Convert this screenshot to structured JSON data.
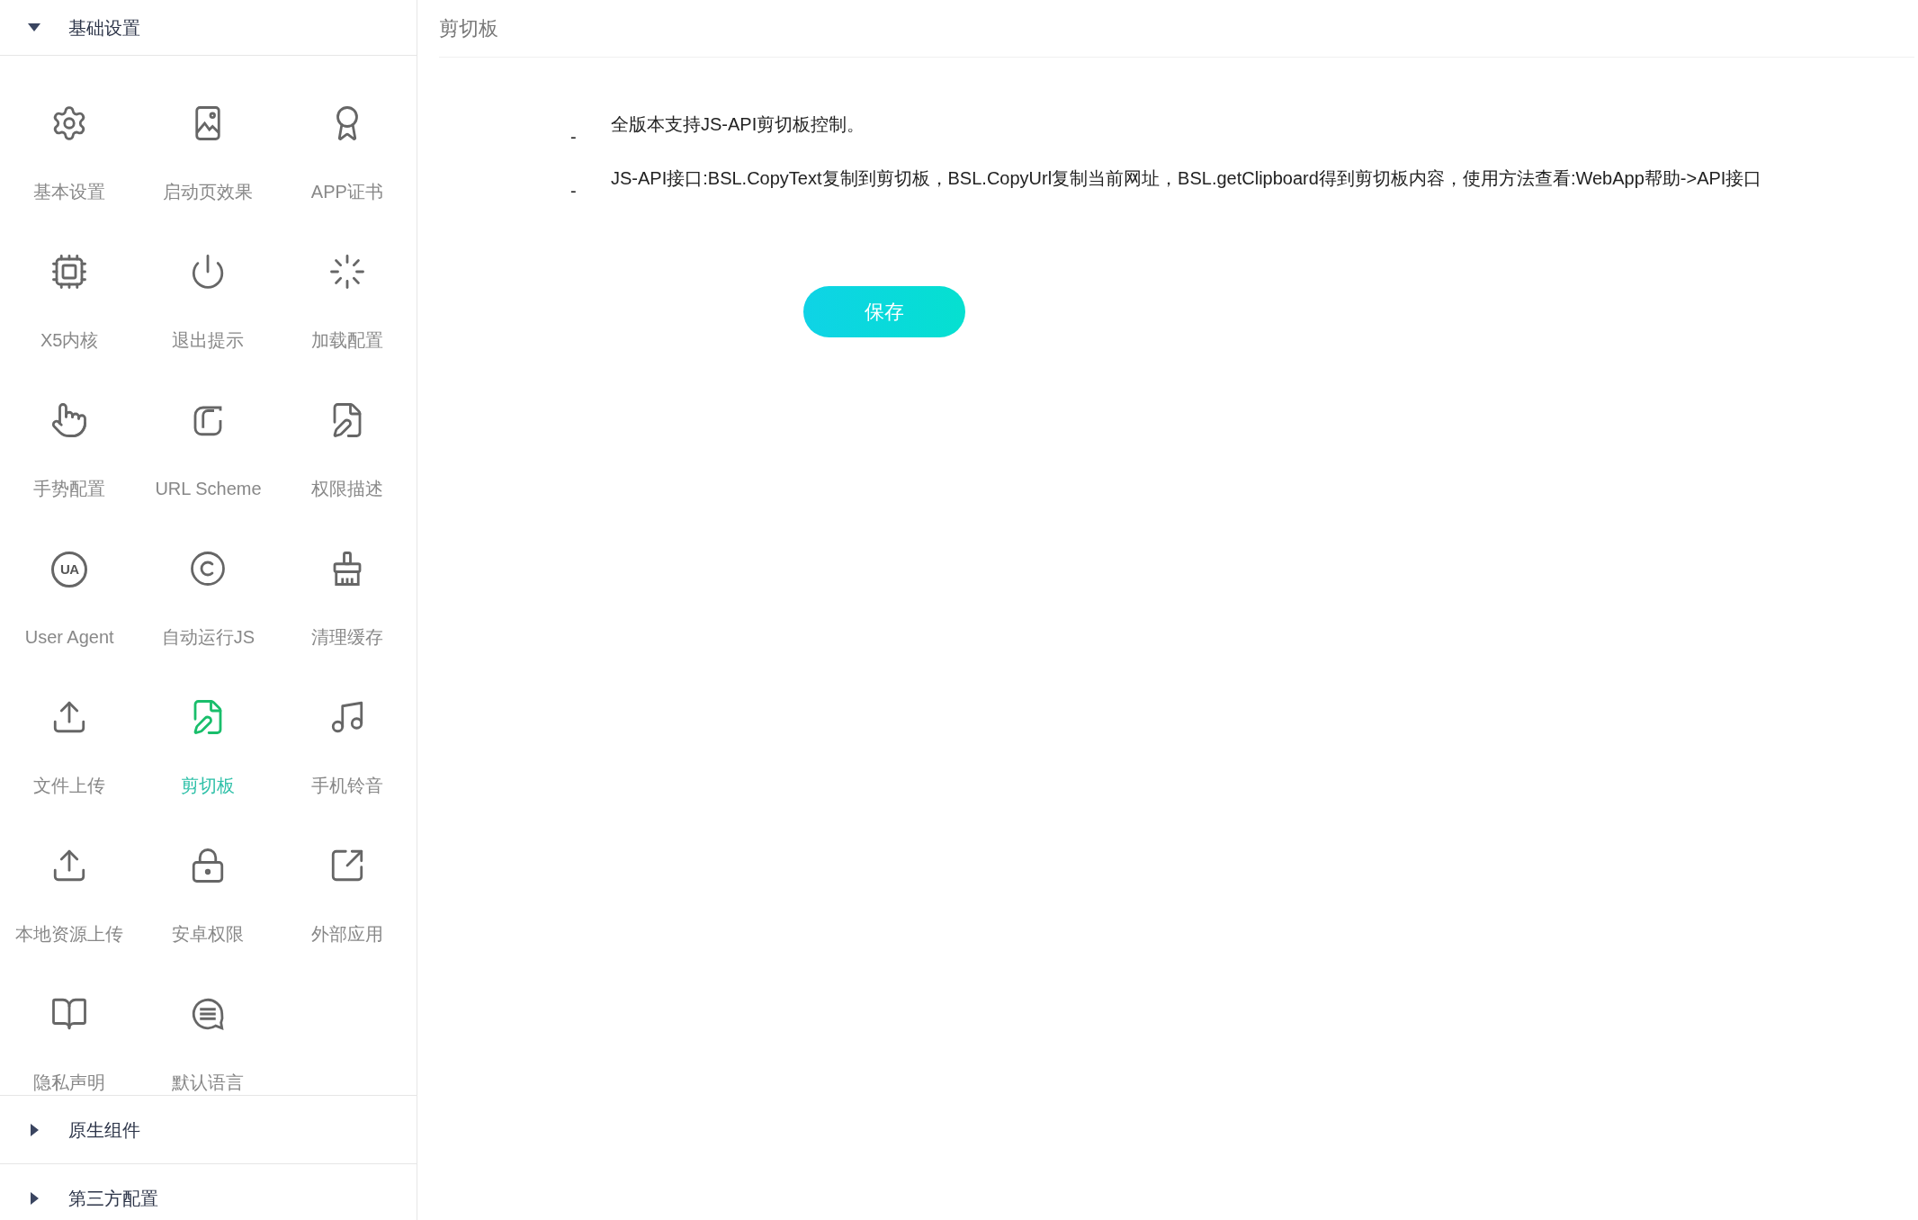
{
  "sidebar": {
    "sections": [
      {
        "title": "基础设置",
        "expanded": true,
        "items": [
          {
            "label": "基本设置",
            "selected": false
          },
          {
            "label": "启动页效果",
            "selected": false
          },
          {
            "label": "APP证书",
            "selected": false
          },
          {
            "label": "X5内核",
            "selected": false
          },
          {
            "label": "退出提示",
            "selected": false
          },
          {
            "label": "加载配置",
            "selected": false
          },
          {
            "label": "手势配置",
            "selected": false
          },
          {
            "label": "URL Scheme",
            "selected": false
          },
          {
            "label": "权限描述",
            "selected": false
          },
          {
            "label": "User Agent",
            "selected": false,
            "badge": "UA"
          },
          {
            "label": "自动运行JS",
            "selected": false
          },
          {
            "label": "清理缓存",
            "selected": false
          },
          {
            "label": "文件上传",
            "selected": false
          },
          {
            "label": "剪切板",
            "selected": true
          },
          {
            "label": "手机铃音",
            "selected": false
          },
          {
            "label": "本地资源上传",
            "selected": false
          },
          {
            "label": "安卓权限",
            "selected": false
          },
          {
            "label": "外部应用",
            "selected": false
          },
          {
            "label": "隐私声明",
            "selected": false
          },
          {
            "label": "默认语言",
            "selected": false
          }
        ]
      },
      {
        "title": "原生组件",
        "expanded": false
      },
      {
        "title": "第三方配置",
        "expanded": false
      }
    ]
  },
  "content": {
    "title": "剪切板",
    "notes": [
      {
        "marker": "-",
        "text": "全版本支持JS-API剪切板控制。"
      },
      {
        "marker": "-",
        "text": "JS-API接口:BSL.CopyText复制到剪切板，BSL.CopyUrl复制当前网址，BSL.getClipboard得到剪切板内容，使用方法查看:WebApp帮助->API接口"
      }
    ],
    "save_button": "保存"
  }
}
